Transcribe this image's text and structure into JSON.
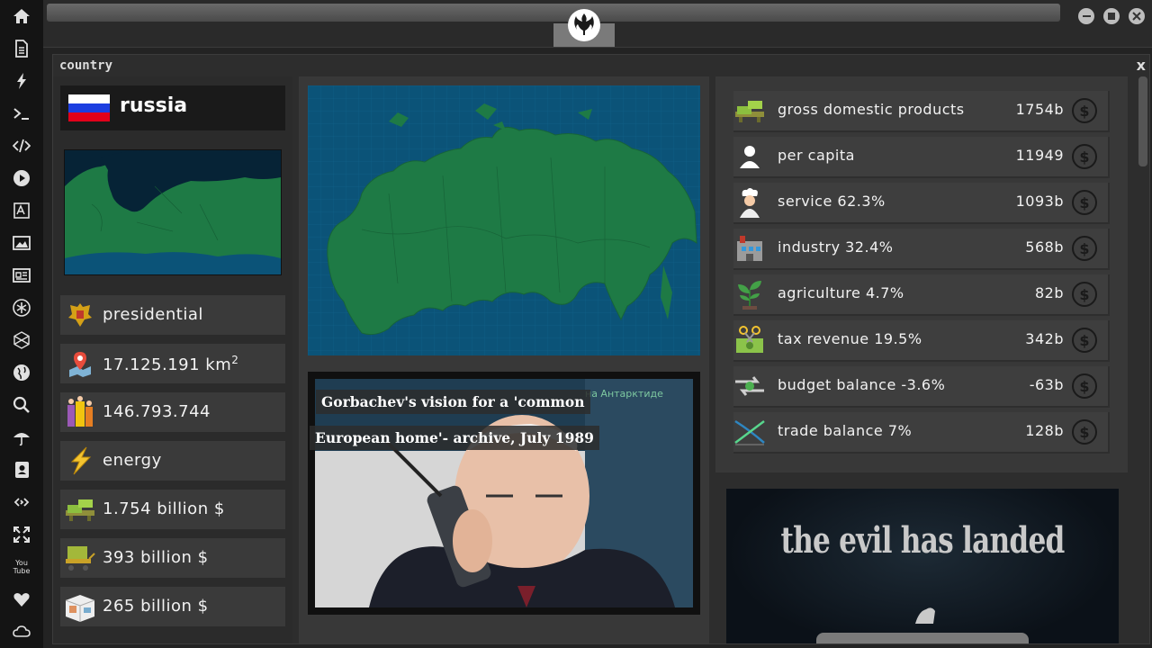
{
  "sidebar": {
    "icons": [
      "home-icon",
      "document-icon",
      "bolt-icon",
      "terminal-icon",
      "code-icon",
      "play-icon",
      "translate-icon",
      "image-icon",
      "newspaper-icon",
      "asterisk-icon",
      "hexagon-icon",
      "globe-icon",
      "search-icon",
      "umbrella-icon",
      "contact-icon",
      "link-icon",
      "expand-icon",
      "youtube-icon",
      "heart-icon",
      "cloud-icon"
    ],
    "youtube_label": "You Tube"
  },
  "window": {
    "title": "country",
    "close_label": "x"
  },
  "country": {
    "name": "russia",
    "flag_colors": [
      "#ffffff",
      "#1c3ee0",
      "#e2001a"
    ],
    "info": [
      {
        "icon": "emblem-icon",
        "text": "presidential"
      },
      {
        "icon": "map-pin-icon",
        "text": "17.125.191 km",
        "sup": "2"
      },
      {
        "icon": "population-icon",
        "text": "146.793.744"
      },
      {
        "icon": "lightning-icon",
        "text": "energy"
      },
      {
        "icon": "money-stack-icon",
        "text": "1.754 billion $"
      },
      {
        "icon": "money-cart-icon",
        "text": "393 billion $"
      },
      {
        "icon": "cargo-box-icon",
        "text": "265 billion $"
      }
    ]
  },
  "news": {
    "headline_line1": "Gorbachev's vision for a 'common",
    "headline_line2": "European home'- archive, July 1989",
    "background_text": "на Антарктиде"
  },
  "economy": {
    "stats": [
      {
        "icon": "money-stack-icon",
        "label": "gross domestic products",
        "value": "1754b"
      },
      {
        "icon": "person-icon",
        "label": "per capita",
        "value": "11949"
      },
      {
        "icon": "chef-icon",
        "label": "service 62.3%",
        "value": "1093b"
      },
      {
        "icon": "factory-icon",
        "label": "industry 32.4%",
        "value": "568b"
      },
      {
        "icon": "plant-icon",
        "label": "agriculture 4.7%",
        "value": "82b"
      },
      {
        "icon": "tax-scissors-icon",
        "label": "tax revenue 19.5%",
        "value": "342b"
      },
      {
        "icon": "budget-arrows-icon",
        "label": "budget balance -3.6%",
        "value": "-63b"
      },
      {
        "icon": "trade-cross-icon",
        "label": "trade balance 7%",
        "value": "128b"
      }
    ],
    "currency_symbol": "$"
  },
  "poster": {
    "title": "the evil has landed"
  }
}
